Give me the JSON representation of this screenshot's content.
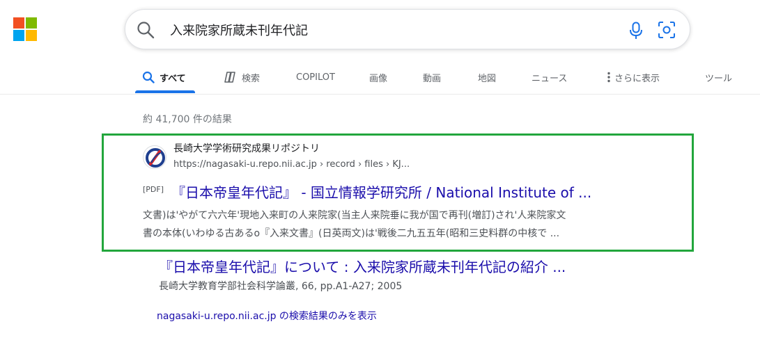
{
  "search": {
    "query": "入来院家所蔵未刊年代記"
  },
  "tabs": [
    {
      "label": "すべて"
    },
    {
      "label": "検索"
    },
    {
      "label": "COPILOT"
    },
    {
      "label": "画像"
    },
    {
      "label": "動画"
    },
    {
      "label": "地図"
    },
    {
      "label": "ニュース"
    },
    {
      "label": "さらに表示"
    },
    {
      "label": "ツール"
    }
  ],
  "results": {
    "count_text": "約 41,700 件の結果",
    "first": {
      "site_name": "長崎大学学術研究成果リポジトリ",
      "url": "https://nagasaki-u.repo.nii.ac.jp › record › files › KJ...",
      "file_type": "[PDF]",
      "title": "『日本帝皇年代記』 - 国立情報学研究所 / National Institute of ...",
      "snippet_line1": "文書)は'やがて六六年'現地入来町の人来院家(当主人来院垂に我が国で再刊(増訂)され'人来院家文",
      "snippet_line2": "書の本体(いわゆる古あるo『入来文書』(日英両文)は'戦後二九五五年(昭和三史料群の中核で ...",
      "sub_title": "『日本帝皇年代記』について : 入来院家所蔵未刊年代記の紹介 ...",
      "sub_meta": "長崎大学教育学部社会科学論叢, 66, pp.A1-A27; 2005",
      "site_only_link": "nagasaki-u.repo.nii.ac.jp の検索結果のみを表示"
    }
  },
  "colors": {
    "accent": "#1a73e8",
    "link": "#1a0dab",
    "highlight": "#22a63c"
  }
}
